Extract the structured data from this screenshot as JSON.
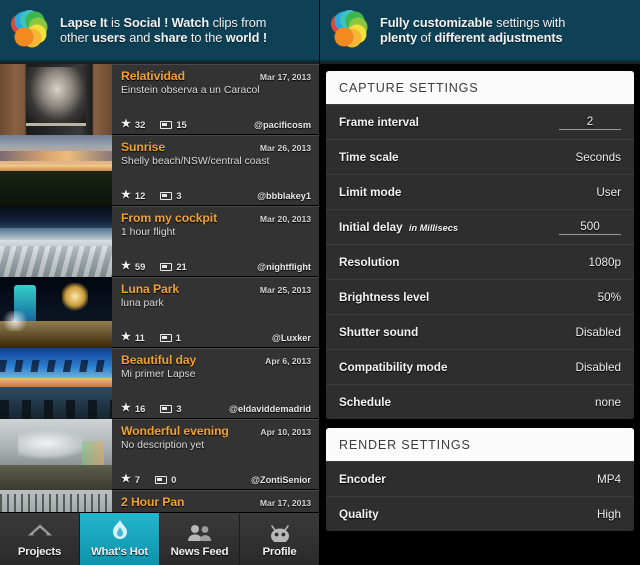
{
  "left_panel": {
    "promo": {
      "logo_icon": "lapse-it-flower-logo",
      "line1_parts": [
        {
          "t": "Lapse It",
          "b": true
        },
        {
          "t": " is ",
          "b": false
        },
        {
          "t": "Social ! Watch",
          "b": true
        },
        {
          "t": " clips from",
          "b": false
        }
      ],
      "line2_parts": [
        {
          "t": "other ",
          "b": false
        },
        {
          "t": "users",
          "b": true
        },
        {
          "t": " and ",
          "b": false
        },
        {
          "t": "share",
          "b": true
        },
        {
          "t": " to the ",
          "b": false
        },
        {
          "t": "world !",
          "b": true
        }
      ],
      "full_text": "Lapse It is Social ! Watch clips from other users and share to the world !"
    },
    "feed": [
      {
        "title": "Relatividad",
        "date": "Mar 17, 2013",
        "desc": "Einstein observa a un Caracol",
        "stars": "32",
        "clips": "15",
        "user": "@pacificosm",
        "thumb": "einstein-poster-brick-wall"
      },
      {
        "title": "Sunrise",
        "date": "Mar 26, 2013",
        "desc": "Shelly beach/NSW/central coast",
        "stars": "12",
        "clips": "3",
        "user": "@bbblakey1",
        "thumb": "sunset-over-field"
      },
      {
        "title": "From my cockpit",
        "date": "Mar 20, 2013",
        "desc": "1 hour flight",
        "stars": "59",
        "clips": "21",
        "user": "@nightflight",
        "thumb": "clouds-from-aircraft"
      },
      {
        "title": "Luna Park",
        "date": "Mar 25, 2013",
        "desc": "luna park",
        "stars": "11",
        "clips": "1",
        "user": "@Luxker",
        "thumb": "amusement-park-night"
      },
      {
        "title": "Beautiful day",
        "date": "Apr 6, 2013",
        "desc": "Mi primer Lapse",
        "stars": "16",
        "clips": "3",
        "user": "@eldaviddemadrid",
        "thumb": "blue-dusk-over-water"
      },
      {
        "title": "Wonderful evening",
        "date": "Apr 10, 2013",
        "desc": "No description yet",
        "stars": "7",
        "clips": "0",
        "user": "@ZontiSenior",
        "thumb": "cloudy-landscape-rainbow"
      },
      {
        "title": "2 Hour Pan",
        "date": "Mar 17, 2013",
        "desc": "",
        "stars": "",
        "clips": "",
        "user": "",
        "thumb": "bare-trees-panorama"
      }
    ],
    "tabs": [
      {
        "label": "Projects",
        "icon": "home-icon",
        "active": false
      },
      {
        "label": "What's Hot",
        "icon": "flame-icon",
        "active": true
      },
      {
        "label": "News Feed",
        "icon": "people-icon",
        "active": false
      },
      {
        "label": "Profile",
        "icon": "android-head-icon",
        "active": false
      }
    ]
  },
  "right_panel": {
    "promo": {
      "logo_icon": "lapse-it-flower-logo",
      "line1_parts": [
        {
          "t": "Fully customizable",
          "b": true
        },
        {
          "t": " settings with",
          "b": false
        }
      ],
      "line2_parts": [
        {
          "t": "plenty",
          "b": true
        },
        {
          "t": " of ",
          "b": false
        },
        {
          "t": "different adjustments",
          "b": true
        }
      ],
      "full_text": "Fully customizable settings with plenty of different adjustments"
    },
    "sections": [
      {
        "header": "CAPTURE SETTINGS",
        "rows": [
          {
            "label": "Frame interval",
            "suffix": "",
            "value": "2",
            "editable": true
          },
          {
            "label": "Time scale",
            "suffix": "",
            "value": "Seconds",
            "editable": false
          },
          {
            "label": "Limit mode",
            "suffix": "",
            "value": "User",
            "editable": false
          },
          {
            "label": "Initial delay",
            "suffix": "in Millisecs",
            "value": "500",
            "editable": true
          },
          {
            "label": "Resolution",
            "suffix": "",
            "value": "1080p",
            "editable": false
          },
          {
            "label": "Brightness level",
            "suffix": "",
            "value": "50%",
            "editable": false
          },
          {
            "label": "Shutter sound",
            "suffix": "",
            "value": "Disabled",
            "editable": false
          },
          {
            "label": "Compatibility mode",
            "suffix": "",
            "value": "Disabled",
            "editable": false
          },
          {
            "label": "Schedule",
            "suffix": "",
            "value": "none",
            "editable": false
          }
        ]
      },
      {
        "header": "RENDER SETTINGS",
        "rows": [
          {
            "label": "Encoder",
            "suffix": "",
            "value": "MP4",
            "editable": false
          },
          {
            "label": "Quality",
            "suffix": "",
            "value": "High",
            "editable": false
          }
        ]
      }
    ]
  },
  "colors": {
    "promo_bg": "#0f4156",
    "accent_orange": "#f0a132",
    "tab_active": "#17a6c0",
    "row_bg": "#333333",
    "settings_row_bg": "#2e2e2e",
    "card_header_bg": "#fbfbfb"
  }
}
